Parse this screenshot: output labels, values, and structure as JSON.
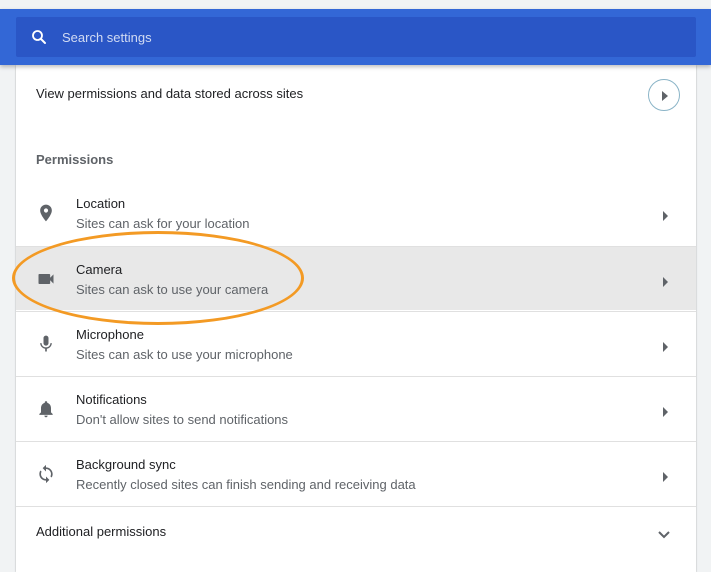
{
  "search": {
    "placeholder": "Search settings"
  },
  "view_permissions": {
    "label": "View permissions and data stored across sites"
  },
  "permissions": {
    "section_title": "Permissions",
    "items": [
      {
        "title": "Location",
        "subtitle": "Sites can ask for your location",
        "icon": "location-pin-icon"
      },
      {
        "title": "Camera",
        "subtitle": "Sites can ask to use your camera",
        "icon": "camera-icon"
      },
      {
        "title": "Microphone",
        "subtitle": "Sites can ask to use your microphone",
        "icon": "microphone-icon"
      },
      {
        "title": "Notifications",
        "subtitle": "Don't allow sites to send notifications",
        "icon": "bell-icon"
      },
      {
        "title": "Background sync",
        "subtitle": "Recently closed sites can finish sending and receiving data",
        "icon": "sync-icon"
      }
    ]
  },
  "additional_permissions": {
    "label": "Additional permissions"
  },
  "colors": {
    "header_blue": "#3367d6",
    "search_box_blue": "#2a56c6",
    "highlight_row": "#e8e8e8",
    "annotation_orange": "#f39a24"
  }
}
